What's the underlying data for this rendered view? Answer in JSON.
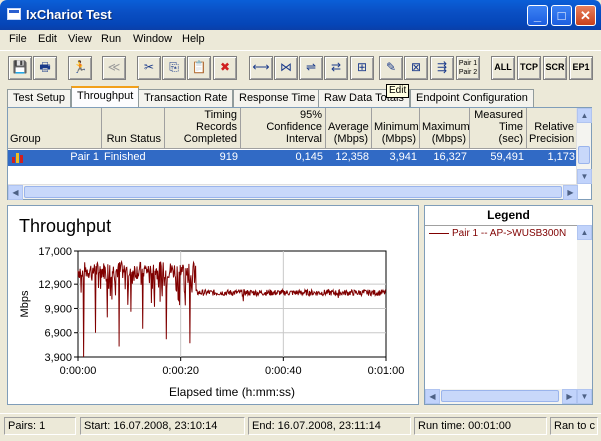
{
  "window": {
    "title": "IxChariot Test"
  },
  "menu": [
    "File",
    "Edit",
    "View",
    "Run",
    "Window",
    "Help"
  ],
  "toolbar": {
    "text_buttons": [
      "ALL",
      "TCP",
      "SCR",
      "EP1"
    ],
    "pairs_button": "Pair 1\nPair 2",
    "tooltip": "Edit"
  },
  "tabs": [
    "Test Setup",
    "Throughput",
    "Transaction Rate",
    "Response Time",
    "Raw Data Totals",
    "Endpoint Configuration"
  ],
  "grid": {
    "columns": [
      "Group",
      "Run Status",
      "Timing Records\nCompleted",
      "95% Confidence\nInterval",
      "Average\n(Mbps)",
      "Minimum\n(Mbps)",
      "Maximum\n(Mbps)",
      "Measured\nTime (sec)",
      "Relative\nPrecision"
    ],
    "row": [
      "Pair 1",
      "Finished",
      "919",
      "0,145",
      "12,358",
      "3,941",
      "16,327",
      "59,491",
      "1,173"
    ]
  },
  "chart_data": {
    "type": "line",
    "title": "Throughput",
    "xlabel": "Elapsed time (h:mm:ss)",
    "ylabel": "Mbps",
    "ylim": [
      3900,
      17000
    ],
    "yticks": [
      "17,000",
      "12,900",
      "9,900",
      "6,900",
      "3,900"
    ],
    "xlim": [
      "0:00:00",
      "0:01:00"
    ],
    "xticks": [
      "0:00:00",
      "0:00:20",
      "0:00:40",
      "0:01:00"
    ],
    "series": [
      {
        "name": "Pair 1 -- AP->WUSB300N",
        "color": "#800000",
        "segments": [
          {
            "from_sec": 0,
            "to_sec": 23,
            "mean": 14600,
            "spread": 1100,
            "dips": [
              3900,
              6900,
              8800,
              5200,
              9500,
              7400,
              10100,
              6100,
              11000,
              5600
            ]
          },
          {
            "from_sec": 23,
            "to_sec": 60,
            "mean": 11850,
            "spread": 380,
            "dips": [
              10800,
              11200
            ]
          }
        ]
      }
    ]
  },
  "legend": {
    "title": "Legend",
    "entry": "Pair 1 -- AP->WUSB300N"
  },
  "status": [
    "Pairs: 1",
    "Start: 16.07.2008, 23:10:14",
    "End: 16.07.2008, 23:11:14",
    "Run time: 00:01:00",
    "Ran to c"
  ]
}
